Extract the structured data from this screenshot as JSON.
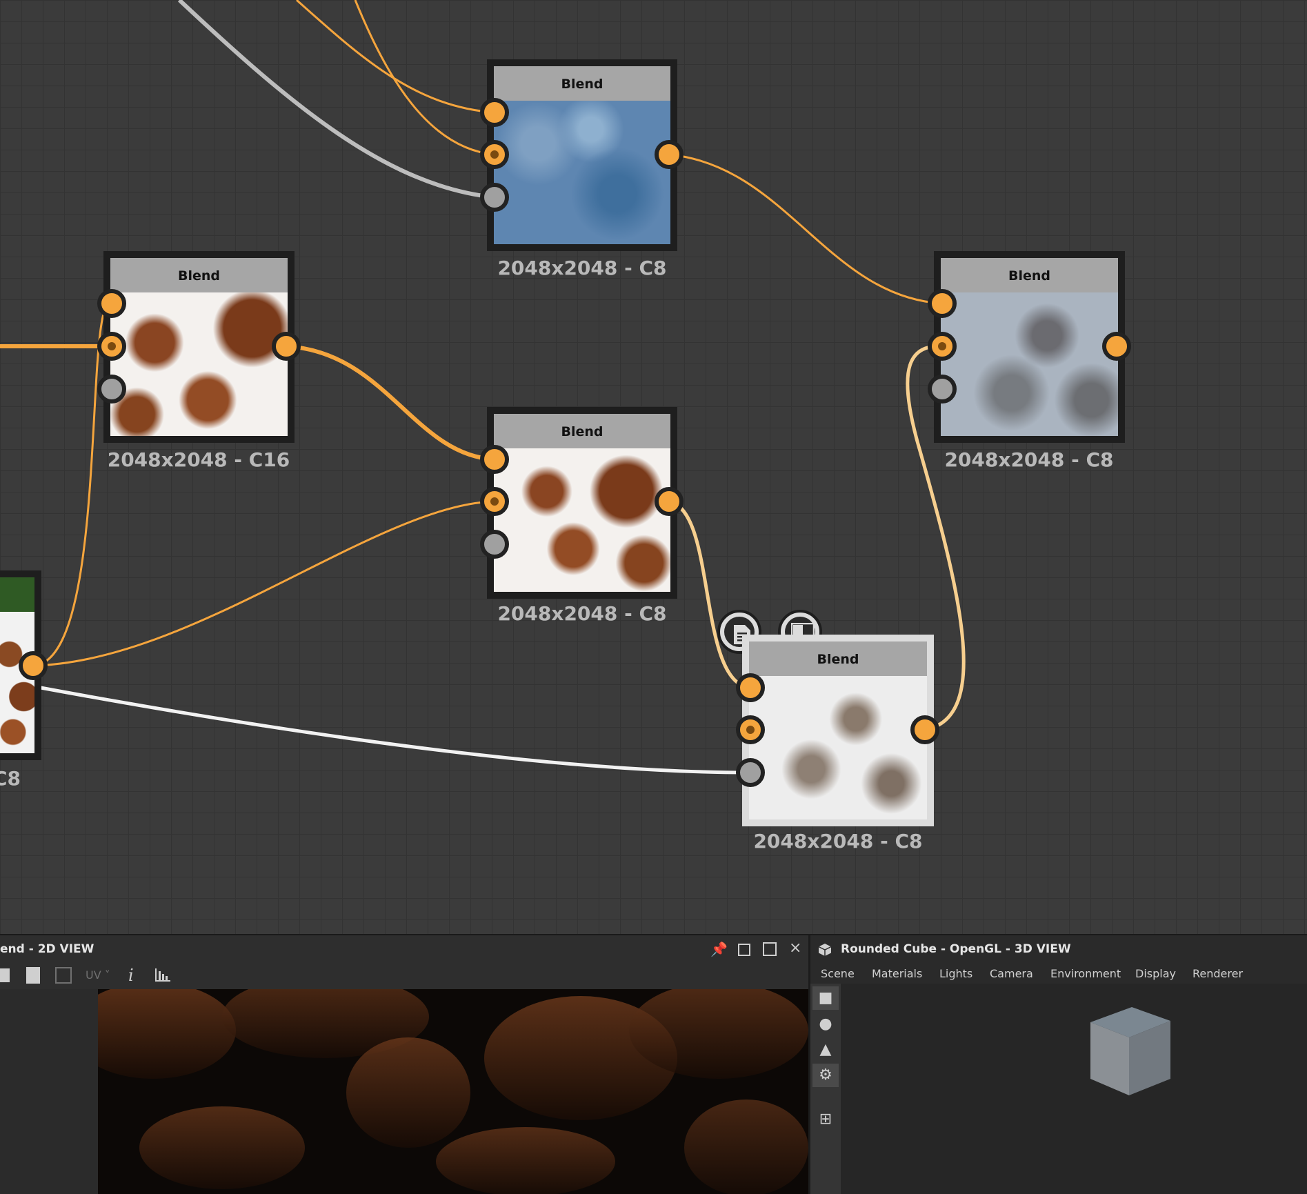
{
  "nodes": [
    {
      "id": "blend_top",
      "title": "Blend",
      "resolution": "2048x2048 - C8",
      "thumbnail": "blue-clouds"
    },
    {
      "id": "blend_left",
      "title": "Blend",
      "resolution": "2048x2048 - C16",
      "thumbnail": "rust-white"
    },
    {
      "id": "blend_middle",
      "title": "Blend",
      "resolution": "2048x2048 - C8",
      "thumbnail": "rust-white"
    },
    {
      "id": "blend_right",
      "title": "Blend",
      "resolution": "2048x2048 - C8",
      "thumbnail": "grey-grunge"
    },
    {
      "id": "blend_selected",
      "title": "Blend",
      "resolution": "2048x2048 - C8",
      "thumbnail": "light-grunge"
    },
    {
      "id": "partial_left",
      "title": "",
      "resolution": "C8",
      "thumbnail": "rust-green"
    }
  ],
  "node_buttons": {
    "document_icon": "document-icon",
    "checker_icon": "checker-icon"
  },
  "panel_2d": {
    "title": "end - 2D VIEW",
    "uv_label": "UV",
    "info_label": "i",
    "icons": [
      "save-icon",
      "copy-icon",
      "tile-icon",
      "uv-dropdown",
      "info-icon",
      "histogram-icon"
    ],
    "window_icons": [
      "pin-icon",
      "float-icon",
      "maximize-icon",
      "close-icon"
    ]
  },
  "panel_3d": {
    "title": "Rounded Cube - OpenGL - 3D VIEW",
    "menu": [
      "Scene",
      "Materials",
      "Lights",
      "Camera",
      "Environment",
      "Display",
      "Renderer"
    ],
    "side_icons": [
      "camera-icon",
      "light-icon",
      "environment-icon",
      "render-icon",
      "wireframe-icon"
    ]
  },
  "colors": {
    "accent_orange": "#f5a53d",
    "port_grey": "#a0a0a0",
    "wire_white": "#f2f2f2",
    "wire_light_orange": "#f7cf8f",
    "node_header": "#a6a6a6",
    "graph_background": "#3b3b3b"
  }
}
